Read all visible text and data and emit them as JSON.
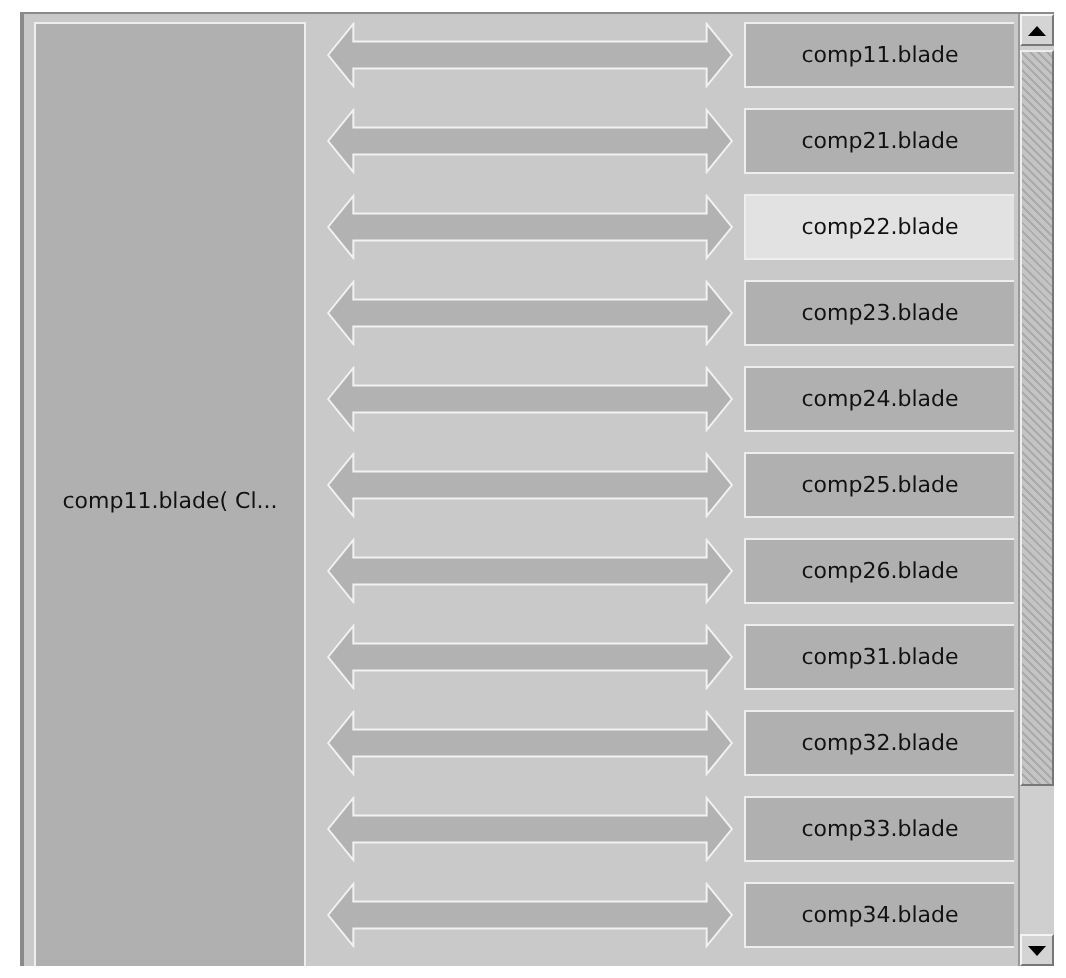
{
  "source": {
    "label": "comp11.blade( Cl..."
  },
  "targets": [
    {
      "label": "comp11.blade",
      "selected": false
    },
    {
      "label": "comp21.blade",
      "selected": false
    },
    {
      "label": "comp22.blade",
      "selected": true
    },
    {
      "label": "comp23.blade",
      "selected": false
    },
    {
      "label": "comp24.blade",
      "selected": false
    },
    {
      "label": "comp25.blade",
      "selected": false
    },
    {
      "label": "comp26.blade",
      "selected": false
    },
    {
      "label": "comp31.blade",
      "selected": false
    },
    {
      "label": "comp32.blade",
      "selected": false
    },
    {
      "label": "comp33.blade",
      "selected": false
    },
    {
      "label": "comp34.blade",
      "selected": false
    }
  ]
}
